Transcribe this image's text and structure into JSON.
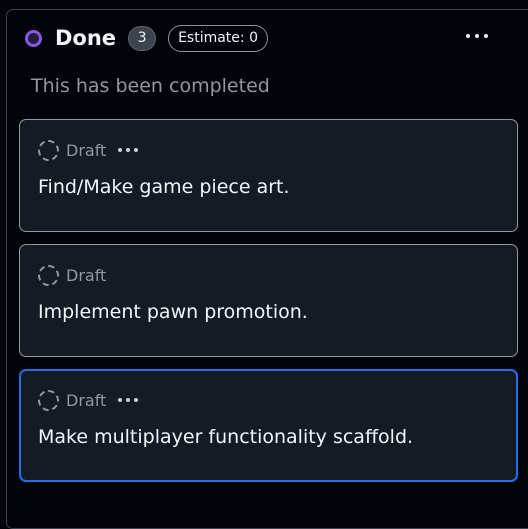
{
  "column": {
    "title": "Done",
    "count": "3",
    "estimate": "Estimate: 0",
    "description": "This has been completed",
    "status_color": "#8957e5",
    "menu_icon": "kebab-horizontal-icon"
  },
  "cards": [
    {
      "status": "Draft",
      "title": "Find/Make game piece art.",
      "has_menu": true,
      "selected": false
    },
    {
      "status": "Draft",
      "title": "Implement pawn promotion.",
      "has_menu": false,
      "selected": false
    },
    {
      "status": "Draft",
      "title": "Make multiplayer functionality scaffold.",
      "has_menu": true,
      "selected": true
    }
  ],
  "colors": {
    "background": "#010409",
    "card_background": "#151b23",
    "selected_border": "#1f6feb",
    "muted_text": "#9198a1"
  }
}
